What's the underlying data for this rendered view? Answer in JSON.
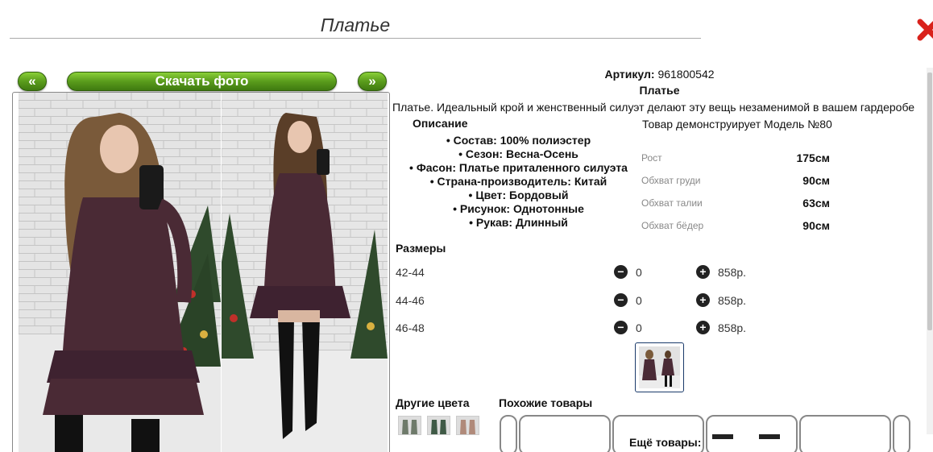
{
  "title": "Платье",
  "gallery": {
    "prev_label": "«",
    "download_label": "Скачать фото",
    "next_label": "»"
  },
  "product": {
    "article_label": "Артикул:",
    "article_value": "961800542",
    "name": "Платье",
    "description": "Платье. Идеальный крой и женственный силуэт делают эту вещь незаменимой в вашем гардеробе",
    "description_heading": "Описание",
    "features": [
      "Состав: 100% полиэстер",
      "Сезон: Весна-Осень",
      "Фасон: Платье приталенного силуэта",
      "Страна-производитель: Китай",
      "Цвет: Бордовый",
      "Рисунок: Однотонные",
      "Рукав: Длинный"
    ]
  },
  "model": {
    "heading": "Товар демонструирует Модель №80",
    "measurements": [
      {
        "label": "Рост",
        "value": "175см"
      },
      {
        "label": "Обхват груди",
        "value": "90см"
      },
      {
        "label": "Обхват талии",
        "value": "63см"
      },
      {
        "label": "Обхват бёдер",
        "value": "90см"
      }
    ]
  },
  "sizes": {
    "heading": "Размеры",
    "rows": [
      {
        "size": "42-44",
        "minus": "−",
        "qty": "0",
        "plus": "+",
        "price": "858р."
      },
      {
        "size": "44-46",
        "minus": "−",
        "qty": "0",
        "plus": "+",
        "price": "858р."
      },
      {
        "size": "46-48",
        "minus": "−",
        "qty": "0",
        "plus": "+",
        "price": "858р."
      }
    ]
  },
  "other_colors_heading": "Другие цвета",
  "similar_heading": "Похожие товары",
  "more_label": "Ещё товары:",
  "icons": {
    "close": "close-x-icon",
    "minus": "minus-circle-icon",
    "plus": "plus-circle-icon"
  },
  "colors": {
    "button_green": "#5a9c1c",
    "close_red": "#d9221c",
    "dress": "#4a2a35"
  }
}
